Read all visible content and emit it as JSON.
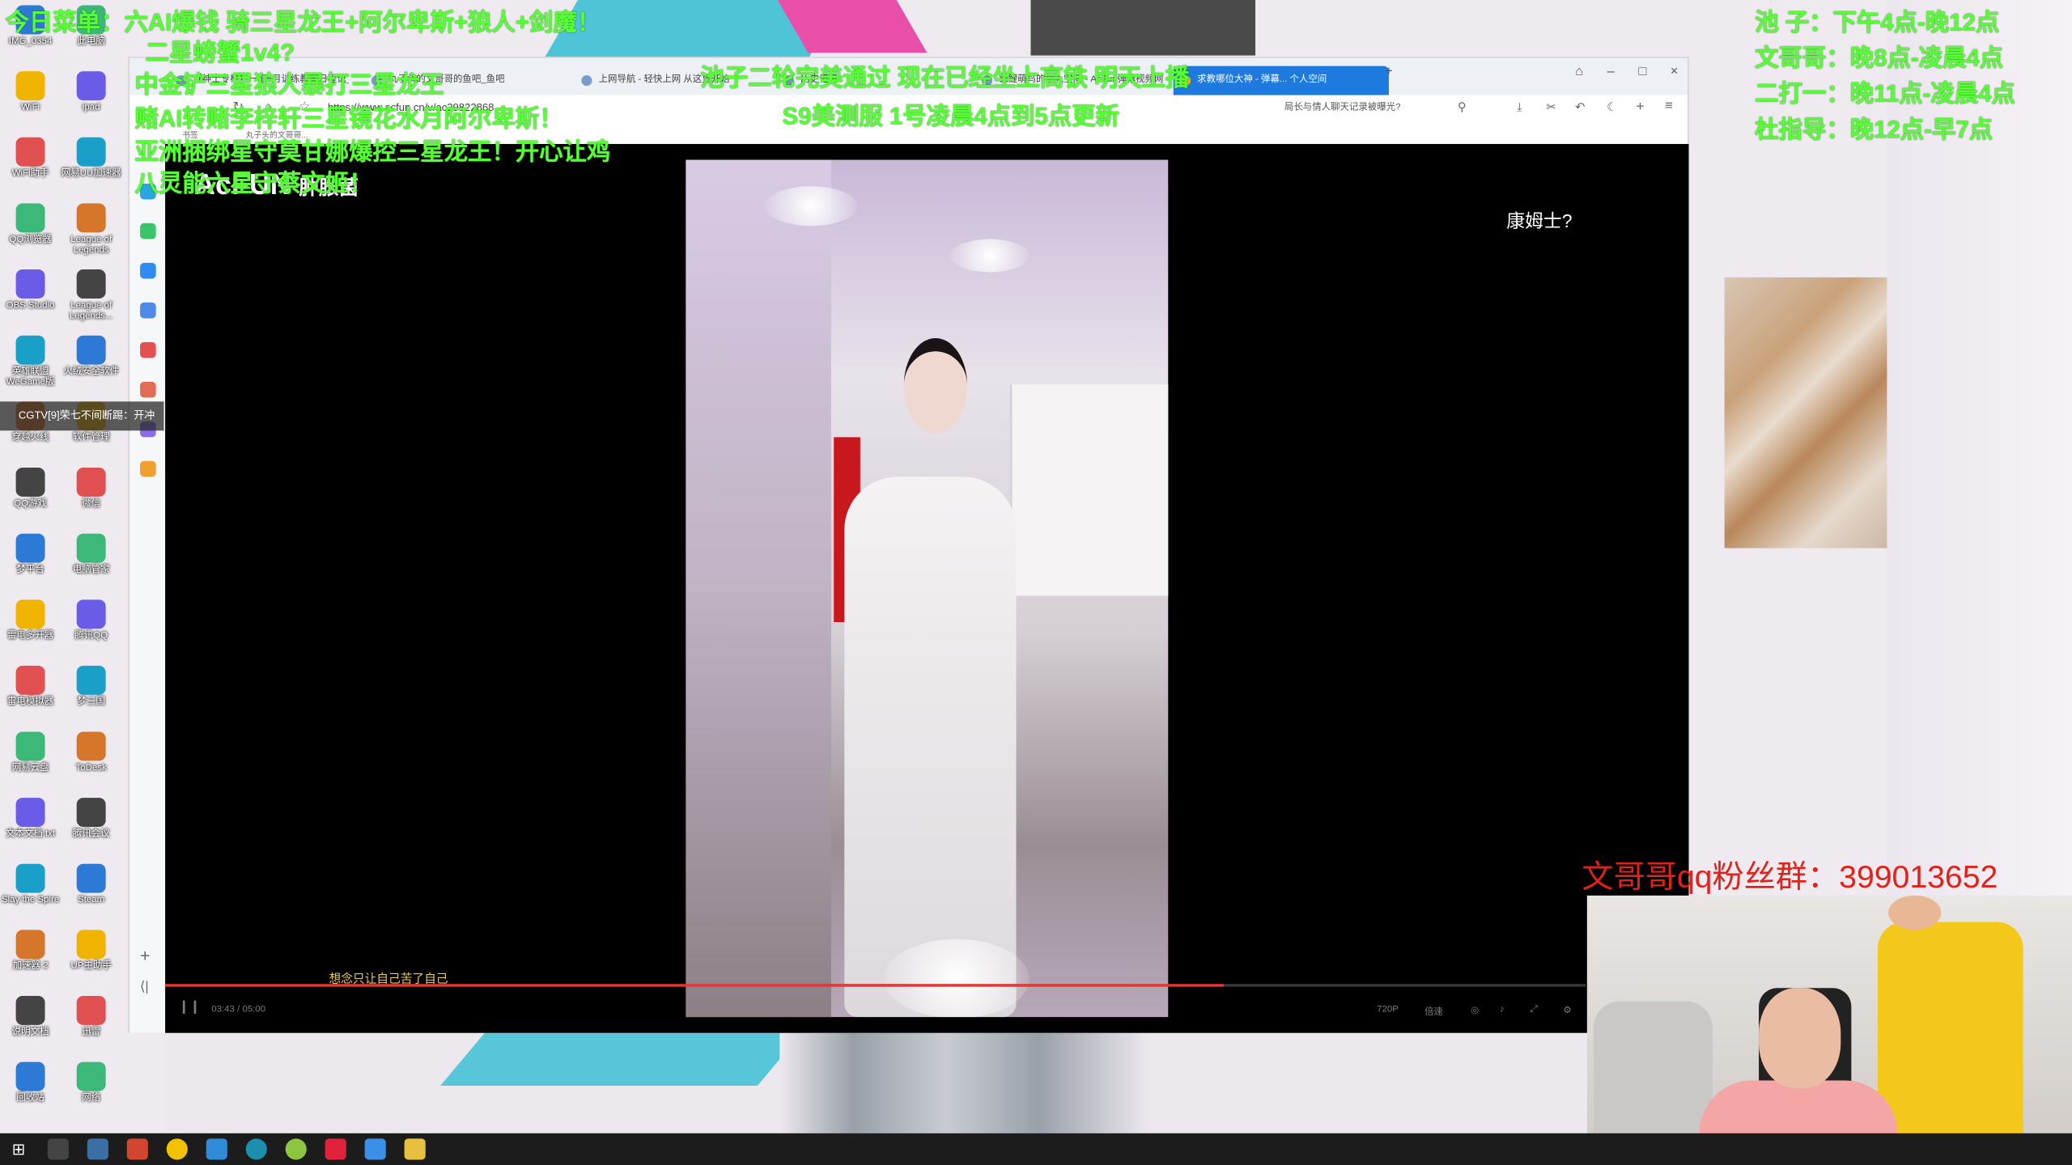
{
  "overlay": {
    "top_left_lines": [
      "今日菜单：六AI爆钱 骑三星龙王+阿尔卑斯+狼人+剑魔！",
      "二星螃蟹1v4?",
      "中金铲三星狼人暴打三星龙王",
      "赌AI转赌李梓轩三星镜花水月阿尔卑斯！",
      "亚洲捆绑星守莫甘娜爆控三星龙王！开心让鸡",
      "八灵能六星守蔡文姬！"
    ],
    "announce_1": "池子二轮完美通过  现在已经坐上高铁 明天上播",
    "announce_2": "S9美测服 1号凌晨4点到5点更新",
    "schedule": [
      "池  子：下午4点-晚12点",
      "文哥哥：晚8点-凌晨4点",
      "二打一：晚11点-凌晨4点",
      "杜指导：晚12点-早7点"
    ],
    "qq_group": "文哥哥qq粉丝群：399013652",
    "tv_overlay_tag": "CGTV[9]荣七不间断踢：开冲"
  },
  "desktop": {
    "icons_left": [
      "IMG_0354",
      "WiFi",
      "WiFi助手",
      "QQ浏览器",
      "OBS Studio",
      "英雄联盟WeGame版",
      "穿越火线",
      "QQ游戏",
      "梦平台",
      "雷电多开器",
      "雷电模拟器",
      "网易云盘",
      "文本文档.txt",
      "Slay the Spire",
      "加速器 2",
      "说明文档",
      "回收站"
    ],
    "icons_right": [
      "此电脑",
      "ipad",
      "网易UU加速器",
      "League of Legends",
      "League of Legends...",
      "火绒安全软件",
      "软件管理",
      "微信",
      "电脑管家",
      "腾讯QQ",
      "梦三国",
      "ToDesk",
      "腾讯会议",
      "Steam",
      "UP主助手",
      "迅雷",
      "网络"
    ]
  },
  "browser": {
    "tabs": [
      {
        "label": "【绅士专栏】一吧6月训练教案日程记_直播..."
      },
      {
        "label": "丸子头的文哥哥的鱼吧_鱼吧"
      },
      {
        "label": "上网导航 - 轻快上网 从这里开始"
      },
      {
        "label": "历史记录"
      },
      {
        "label": "锦鲤萌鸟的个人空间 - AcFun弹幕视频网"
      },
      {
        "label": "求教哪位大神 - 弹幕... 个人空间"
      }
    ],
    "url": "https://www.acfun.cn/v/ac29822868",
    "search_hint": "局长与情人聊天记录被曝光?",
    "bookmarks": [
      "书签",
      "丸子头的文哥哥..."
    ]
  },
  "video": {
    "logo": "AcFUN",
    "logo_sub": "肿胀菌",
    "top_question": "康姆士?",
    "subtitle": "想念只让自己苦了自己",
    "time": "03:43 / 05:00",
    "quality": "720P",
    "speed": "倍速",
    "progress": 0.745
  },
  "colors": {
    "overlay_green": "#55ff33",
    "qq_red": "#e0221a",
    "tab_active": "#1f7ae0",
    "progress": "#ee3333"
  }
}
